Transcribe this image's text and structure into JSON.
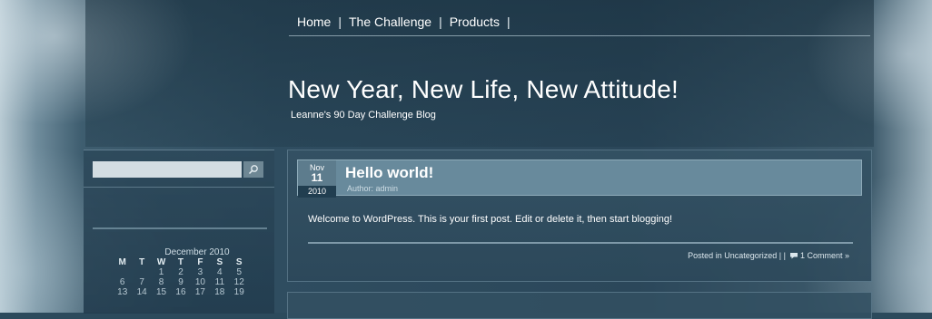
{
  "nav": {
    "items": [
      "Home",
      "The Challenge",
      "Products"
    ],
    "separator": "|"
  },
  "site": {
    "title": "New Year, New Life, New Attitude!",
    "tagline": "Leanne's 90 Day Challenge Blog"
  },
  "search": {
    "value": "",
    "button_icon": "search-icon"
  },
  "calendar": {
    "caption": "December 2010",
    "days": [
      "M",
      "T",
      "W",
      "T",
      "F",
      "S",
      "S"
    ],
    "rows": [
      [
        "",
        "",
        "1",
        "2",
        "3",
        "4",
        "5"
      ],
      [
        "6",
        "7",
        "8",
        "9",
        "10",
        "11",
        "12"
      ],
      [
        "13",
        "14",
        "15",
        "16",
        "17",
        "18",
        "19"
      ]
    ]
  },
  "post": {
    "date": {
      "month": "Nov",
      "day": "11",
      "year": "2010"
    },
    "title": "Hello world!",
    "author": "Author: admin",
    "body": "Welcome to WordPress. This is your first post. Edit or delete it, then start blogging!",
    "posted_in": "Posted in",
    "category": "Uncategorized",
    "meta_sep": "|  |",
    "comment_icon": "comment-icon",
    "comments": "1 Comment »"
  },
  "colors": {
    "background": "#2c4a5c",
    "post_header": "#688a9c",
    "date_year_bg": "#213e50",
    "text": "#ffffff"
  }
}
